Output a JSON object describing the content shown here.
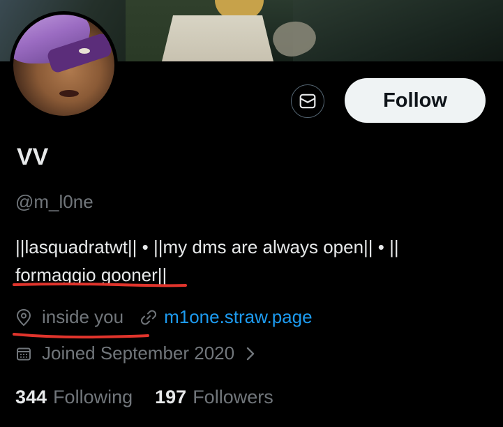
{
  "profile": {
    "display_name": "VV",
    "handle": "@m_l0ne",
    "bio": {
      "line1": "||lasquadratwt|| • ||my dms are always open|| • ||",
      "line2": "formaggio gooner||"
    },
    "location": "inside you",
    "website": "m1one.straw.page",
    "joined": "Joined September 2020",
    "following_count": "344",
    "following_label": "Following",
    "followers_count": "197",
    "followers_label": "Followers"
  },
  "actions": {
    "follow_label": "Follow",
    "message_icon": "envelope-icon"
  },
  "annotations": {
    "underline_color": "#e0342c"
  },
  "colors": {
    "background": "#000000",
    "text_primary": "#e7e9ea",
    "text_secondary": "#71767b",
    "link": "#1d9bf0",
    "follow_bg": "#eff3f4"
  }
}
